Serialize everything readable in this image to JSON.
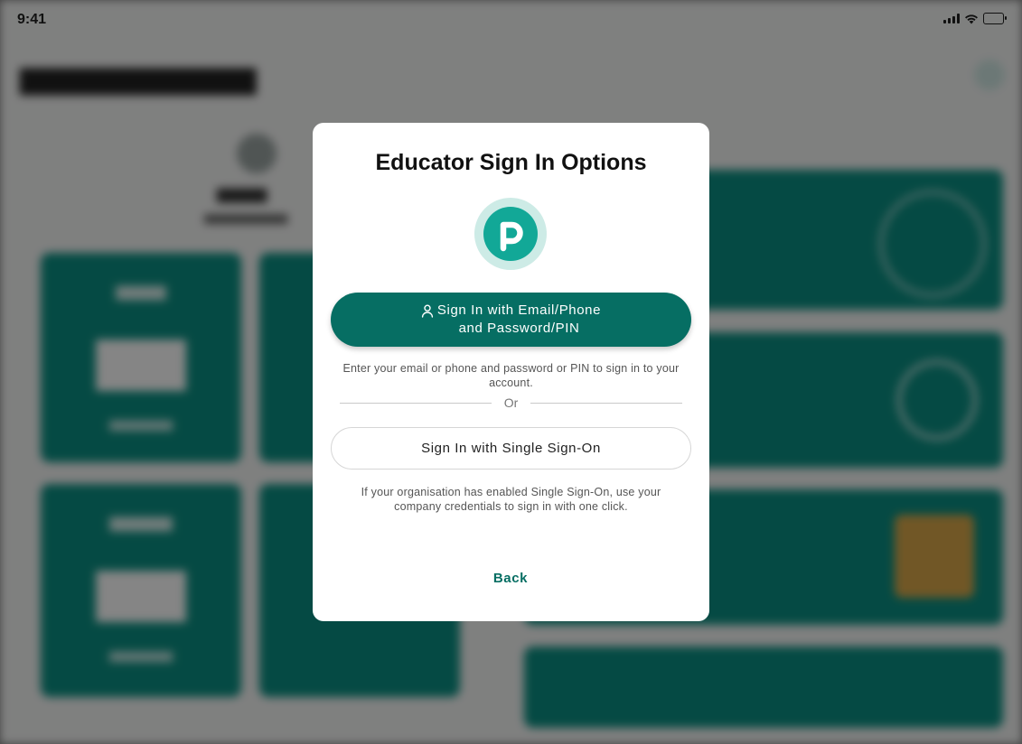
{
  "status_bar": {
    "time": "9:41"
  },
  "modal": {
    "title": "Educator Sign In Options",
    "logo_icon": "p-logo-icon",
    "primary_button": {
      "icon": "user-icon",
      "label_line1": "Sign In with Email/Phone",
      "label_line2": "and Password/PIN"
    },
    "primary_help": "Enter your email or phone and password or PIN to sign in to your account.",
    "divider_text": "Or",
    "sso_button": {
      "label": "Sign In with Single Sign-On"
    },
    "sso_help": "If your organisation has enabled Single Sign-On, use your company credentials to sign in with one click.",
    "back_label": "Back"
  },
  "colors": {
    "primary": "#066e63",
    "logo": "#12a897",
    "logo_ring": "#cdebe6",
    "background_cards": "#0b8f82"
  }
}
